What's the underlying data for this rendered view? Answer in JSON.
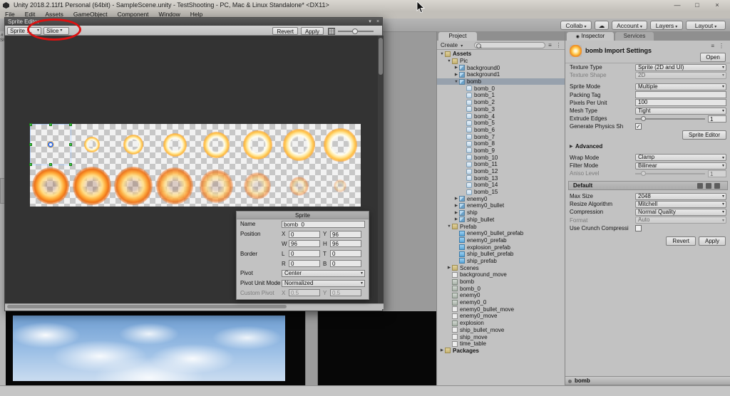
{
  "titlebar": {
    "title": "Unity 2018.2.11f1 Personal (64bit) - SampleScene.unity - TestShooting - PC, Mac & Linux Standalone* <DX11>",
    "minimize": "—",
    "maximize": "□",
    "close": "×"
  },
  "menubar": {
    "items": [
      "File",
      "Edit",
      "Assets",
      "GameObject",
      "Component",
      "Window",
      "Help"
    ]
  },
  "main_toolbar": {
    "collab": "Collab",
    "cloud_icon": "☁",
    "account": "Account",
    "layers": "Layers",
    "layout": "Layout"
  },
  "scene_sliver": {
    "tab": "#",
    "label": "Sh"
  },
  "sprite_editor_window": {
    "title": "Sprite Editor",
    "mode_dropdown": "Sprite Editor",
    "slice_dropdown": "Slice",
    "revert": "Revert",
    "apply": "Apply",
    "sprite_panel": {
      "title": "Sprite",
      "name_label": "Name",
      "name": "bomb_0",
      "position_label": "Position",
      "x_label": "X",
      "x": "0",
      "y_label": "Y",
      "y": "96",
      "w_label": "W",
      "w": "96",
      "h_label": "H",
      "h": "96",
      "border_label": "Border",
      "l_label": "L",
      "l": "0",
      "t_label": "T",
      "t": "0",
      "r_label": "R",
      "r": "0",
      "b_label": "B",
      "b": "0",
      "pivot_label": "Pivot",
      "pivot": "Center",
      "pivot_unit_mode_label": "Pivot Unit Mode",
      "pivot_unit_mode": "Normalized",
      "custom_pivot_label": "Custom Pivot",
      "cp_x_label": "X",
      "cp_x": "0.5",
      "cp_y_label": "Y",
      "cp_y": "0.5"
    }
  },
  "project_panel": {
    "tab": "Project",
    "create": "Create",
    "tree": [
      {
        "label": "Assets",
        "depth": 0,
        "icon": "folder",
        "arrow": "open",
        "bold": true
      },
      {
        "label": "Pic",
        "depth": 1,
        "icon": "folder",
        "arrow": "open"
      },
      {
        "label": "background0",
        "depth": 2,
        "icon": "image",
        "arrow": "closed"
      },
      {
        "label": "background1",
        "depth": 2,
        "icon": "image",
        "arrow": "closed"
      },
      {
        "label": "bomb",
        "depth": 2,
        "icon": "image",
        "arrow": "open",
        "selected": true
      },
      {
        "label": "bomb_0",
        "depth": 3,
        "icon": "sprite"
      },
      {
        "label": "bomb_1",
        "depth": 3,
        "icon": "sprite"
      },
      {
        "label": "bomb_2",
        "depth": 3,
        "icon": "sprite"
      },
      {
        "label": "bomb_3",
        "depth": 3,
        "icon": "sprite"
      },
      {
        "label": "bomb_4",
        "depth": 3,
        "icon": "sprite"
      },
      {
        "label": "bomb_5",
        "depth": 3,
        "icon": "sprite"
      },
      {
        "label": "bomb_6",
        "depth": 3,
        "icon": "sprite"
      },
      {
        "label": "bomb_7",
        "depth": 3,
        "icon": "sprite"
      },
      {
        "label": "bomb_8",
        "depth": 3,
        "icon": "sprite"
      },
      {
        "label": "bomb_9",
        "depth": 3,
        "icon": "sprite"
      },
      {
        "label": "bomb_10",
        "depth": 3,
        "icon": "sprite"
      },
      {
        "label": "bomb_11",
        "depth": 3,
        "icon": "sprite"
      },
      {
        "label": "bomb_12",
        "depth": 3,
        "icon": "sprite"
      },
      {
        "label": "bomb_13",
        "depth": 3,
        "icon": "sprite"
      },
      {
        "label": "bomb_14",
        "depth": 3,
        "icon": "sprite"
      },
      {
        "label": "bomb_15",
        "depth": 3,
        "icon": "sprite"
      },
      {
        "label": "enemy0",
        "depth": 2,
        "icon": "image",
        "arrow": "closed"
      },
      {
        "label": "enemy0_bullet",
        "depth": 2,
        "icon": "image",
        "arrow": "closed"
      },
      {
        "label": "ship",
        "depth": 2,
        "icon": "image",
        "arrow": "closed"
      },
      {
        "label": "ship_bullet",
        "depth": 2,
        "icon": "image",
        "arrow": "closed"
      },
      {
        "label": "Prefab",
        "depth": 1,
        "icon": "folder",
        "arrow": "open"
      },
      {
        "label": "enemy0_bullet_prefab",
        "depth": 2,
        "icon": "prefab"
      },
      {
        "label": "enemy0_prefab",
        "depth": 2,
        "icon": "prefab"
      },
      {
        "label": "explosion_prefab",
        "depth": 2,
        "icon": "prefab"
      },
      {
        "label": "ship_bullet_prefab",
        "depth": 2,
        "icon": "prefab"
      },
      {
        "label": "ship_prefab",
        "depth": 2,
        "icon": "prefab"
      },
      {
        "label": "Scenes",
        "depth": 1,
        "icon": "folder",
        "arrow": "closed"
      },
      {
        "label": "background_move",
        "depth": 1,
        "icon": "script"
      },
      {
        "label": "bomb",
        "depth": 1,
        "icon": "anim"
      },
      {
        "label": "bomb_0",
        "depth": 1,
        "icon": "anim"
      },
      {
        "label": "enemy0",
        "depth": 1,
        "icon": "anim"
      },
      {
        "label": "enemy0_0",
        "depth": 1,
        "icon": "anim"
      },
      {
        "label": "enemy0_bullet_move",
        "depth": 1,
        "icon": "script"
      },
      {
        "label": "enemy0_move",
        "depth": 1,
        "icon": "script"
      },
      {
        "label": "explosion",
        "depth": 1,
        "icon": "anim"
      },
      {
        "label": "ship_bullet_move",
        "depth": 1,
        "icon": "script"
      },
      {
        "label": "ship_move",
        "depth": 1,
        "icon": "script"
      },
      {
        "label": "time_table",
        "depth": 1,
        "icon": "script"
      },
      {
        "label": "Packages",
        "depth": 0,
        "icon": "folder",
        "arrow": "closed",
        "bold": true
      }
    ]
  },
  "inspector_panel": {
    "tab_inspector": "Inspector",
    "tab_services": "Services",
    "title": "bomb Import Settings",
    "open": "Open",
    "rows": [
      {
        "label": "Texture Type",
        "type": "dropdown",
        "value": "Sprite (2D and UI)"
      },
      {
        "label": "Texture Shape",
        "type": "dropdown",
        "value": "2D",
        "disabled": true
      },
      {
        "type": "gap"
      },
      {
        "label": "Sprite Mode",
        "type": "dropdown",
        "value": "Multiple"
      },
      {
        "label": "Packing Tag",
        "type": "text",
        "value": ""
      },
      {
        "label": "Pixels Per Unit",
        "type": "text",
        "value": "100"
      },
      {
        "label": "Mesh Type",
        "type": "dropdown",
        "value": "Tight"
      },
      {
        "label": "Extrude Edges",
        "type": "slider",
        "value": "1"
      },
      {
        "label": "Generate Physics Sh",
        "type": "checkbox",
        "checked": true
      },
      {
        "type": "button-right",
        "value": "Sprite Editor"
      },
      {
        "type": "gap"
      },
      {
        "label": "Advanced",
        "type": "foldout"
      },
      {
        "type": "gap"
      },
      {
        "label": "Wrap Mode",
        "type": "dropdown",
        "value": "Clamp"
      },
      {
        "label": "Filter Mode",
        "type": "dropdown",
        "value": "Bilinear"
      },
      {
        "label": "Aniso Level",
        "type": "slider",
        "value": "1",
        "disabled": true
      }
    ],
    "platform_tab": "Default",
    "platform_rows": [
      {
        "label": "Max Size",
        "type": "dropdown",
        "value": "2048"
      },
      {
        "label": "Resize Algorithm",
        "type": "dropdown",
        "value": "Mitchell"
      },
      {
        "label": "Compression",
        "type": "dropdown",
        "value": "Normal Quality"
      },
      {
        "label": "Format",
        "type": "dropdown",
        "value": "Auto",
        "disabled": true
      },
      {
        "label": "Use Crunch Compressi",
        "type": "checkbox",
        "checked": false
      }
    ],
    "revert": "Revert",
    "apply": "Apply",
    "preview_title": "bomb"
  }
}
